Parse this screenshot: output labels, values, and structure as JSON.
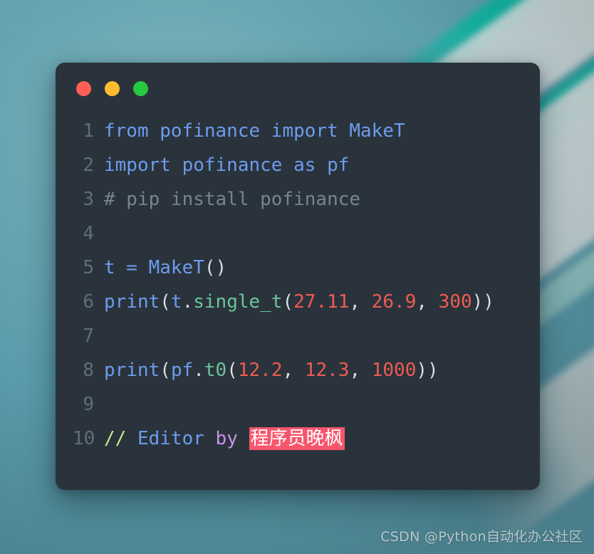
{
  "window": {
    "traffic_lights": [
      {
        "name": "close",
        "color": "#ff5f57"
      },
      {
        "name": "minimize",
        "color": "#febc2e"
      },
      {
        "name": "maximize",
        "color": "#28c840"
      }
    ],
    "background_color": "#2a333b"
  },
  "editor": {
    "lines": [
      {
        "number": "1",
        "text": "from pofinance import MakeT",
        "tokens": [
          {
            "text": "from pofinance import MakeT",
            "style": "t-kw"
          }
        ]
      },
      {
        "number": "2",
        "text": "import pofinance as pf",
        "tokens": [
          {
            "text": "import pofinance as pf",
            "style": "t-kw"
          }
        ]
      },
      {
        "number": "3",
        "text": "# pip install pofinance",
        "tokens": [
          {
            "text": "# pip install pofinance",
            "style": "t-comm"
          }
        ]
      },
      {
        "number": "4",
        "text": "",
        "tokens": []
      },
      {
        "number": "5",
        "text": "t = MakeT()",
        "tokens": [
          {
            "text": "t = MakeT",
            "style": "t-blue"
          },
          {
            "text": "()",
            "style": "t-plain"
          }
        ]
      },
      {
        "number": "6",
        "text": "print(t.single_t(27.11, 26.9, 300))",
        "tokens": [
          {
            "text": "print",
            "style": "t-blue"
          },
          {
            "text": "(",
            "style": "t-plain"
          },
          {
            "text": "t",
            "style": "t-blue"
          },
          {
            "text": ".",
            "style": "t-plain"
          },
          {
            "text": "single_t",
            "style": "t-fn"
          },
          {
            "text": "(",
            "style": "t-plain"
          },
          {
            "text": "27.11",
            "style": "t-num"
          },
          {
            "text": ", ",
            "style": "t-plain"
          },
          {
            "text": "26.9",
            "style": "t-num"
          },
          {
            "text": ", ",
            "style": "t-plain"
          },
          {
            "text": "300",
            "style": "t-num"
          },
          {
            "text": "))",
            "style": "t-plain"
          }
        ]
      },
      {
        "number": "7",
        "text": "",
        "tokens": []
      },
      {
        "number": "8",
        "text": "print(pf.t0(12.2, 12.3, 1000))",
        "tokens": [
          {
            "text": "print",
            "style": "t-blue"
          },
          {
            "text": "(",
            "style": "t-plain"
          },
          {
            "text": "pf",
            "style": "t-blue"
          },
          {
            "text": ".",
            "style": "t-plain"
          },
          {
            "text": "t0",
            "style": "t-fn"
          },
          {
            "text": "(",
            "style": "t-plain"
          },
          {
            "text": "12.2",
            "style": "t-num"
          },
          {
            "text": ", ",
            "style": "t-plain"
          },
          {
            "text": "12.3",
            "style": "t-num"
          },
          {
            "text": ", ",
            "style": "t-plain"
          },
          {
            "text": "1000",
            "style": "t-num"
          },
          {
            "text": "))",
            "style": "t-plain"
          }
        ]
      },
      {
        "number": "9",
        "text": "",
        "tokens": []
      },
      {
        "number": "10",
        "text": "// Editor by 程序员晚枫",
        "tokens": [
          {
            "text": "// ",
            "style": "t-slash"
          },
          {
            "text": "Editor ",
            "style": "t-blue"
          },
          {
            "text": "by ",
            "style": "t-by"
          },
          {
            "text": "程序员晚枫",
            "style": "hl"
          }
        ]
      }
    ]
  },
  "watermark": {
    "text": "CSDN @Python自动化办公社区"
  },
  "colors": {
    "keyword": "#6c9ced",
    "comment": "#76858d",
    "function": "#6cc49a",
    "number": "#ef5b52",
    "punctuation": "#d8dee4",
    "line_number": "#5d7079",
    "highlight_bg": "#f8556d",
    "slash_comment": "#c3e88d",
    "by_keyword": "#c792ea"
  }
}
